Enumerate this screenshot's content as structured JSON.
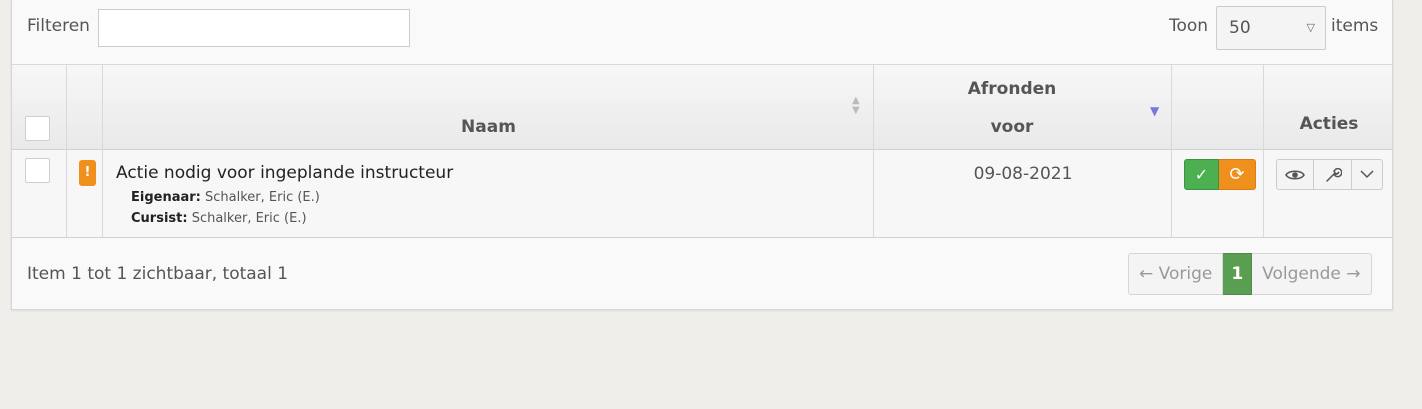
{
  "filter": {
    "label": "Filteren",
    "placeholder": ""
  },
  "page_size": {
    "label_before": "Toon",
    "selected": "50",
    "label_after": "items"
  },
  "table": {
    "columns": {
      "name": "Naam",
      "due_line1": "Afronden",
      "due_line2": "voor",
      "actions": "Acties"
    },
    "rows": [
      {
        "badge": "!",
        "title": "Actie nodig voor ingeplande instructeur",
        "owner_label": "Eigenaar:",
        "owner": "Schalker, Eric (E.)",
        "student_label": "Cursist:",
        "student": "Schalker, Eric (E.)",
        "due": "09-08-2021"
      }
    ]
  },
  "footer": {
    "info": "Item 1 tot 1 zichtbaar, totaal 1"
  },
  "pagination": {
    "prev": "← Vorige",
    "current": "1",
    "next": "Volgende →"
  },
  "icons": {
    "check": "check-icon",
    "sync": "sync-icon",
    "view": "eye-icon",
    "edit": "wrench-icon",
    "more": "chevron-down-icon"
  },
  "colors": {
    "success": "#4caf50",
    "warning": "#f0901c",
    "active_page": "#5a9e52"
  }
}
